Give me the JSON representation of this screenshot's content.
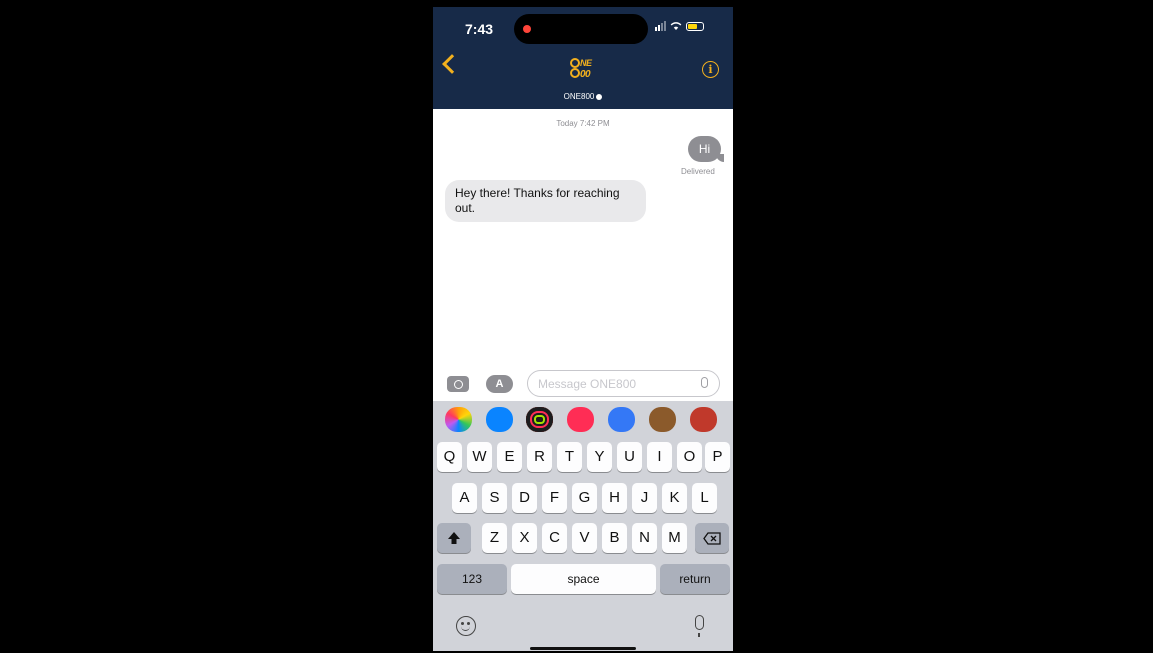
{
  "status_bar": {
    "time": "7:43"
  },
  "header": {
    "logo_text": "ONE 800",
    "contact_name": "ONE800"
  },
  "conversation": {
    "timestamp": "Today 7:42 PM",
    "messages": [
      {
        "direction": "outgoing",
        "text": "Hi",
        "status": "Delivered"
      },
      {
        "direction": "incoming",
        "text": "Hey there! Thanks for reaching out."
      }
    ]
  },
  "composer": {
    "placeholder": "Message ONE800",
    "value": ""
  },
  "app_strip": {
    "apps": [
      "photos-app-icon",
      "app-store-icon",
      "fitness-app-icon",
      "search-images-icon",
      "audio-message-icon",
      "memoji-icon",
      "animoji-icon"
    ],
    "colors": [
      "#ff9f0a",
      "#0a84ff",
      "#1c1c1e",
      "#ff2d55",
      "#3478f6",
      "#8b5a2b",
      "#c0392b"
    ]
  },
  "keyboard": {
    "row1": [
      "Q",
      "W",
      "E",
      "R",
      "T",
      "Y",
      "U",
      "I",
      "O",
      "P"
    ],
    "row2": [
      "A",
      "S",
      "D",
      "F",
      "G",
      "H",
      "J",
      "K",
      "L"
    ],
    "row3": [
      "Z",
      "X",
      "C",
      "V",
      "B",
      "N",
      "M"
    ],
    "numbers_label": "123",
    "space_label": "space",
    "return_label": "return"
  },
  "colors": {
    "header_bg": "#172a48",
    "accent": "#f2b01e",
    "outgoing_bubble": "#8e8e93",
    "incoming_bubble": "#e9e9eb",
    "keyboard_bg": "#d1d3d9"
  }
}
